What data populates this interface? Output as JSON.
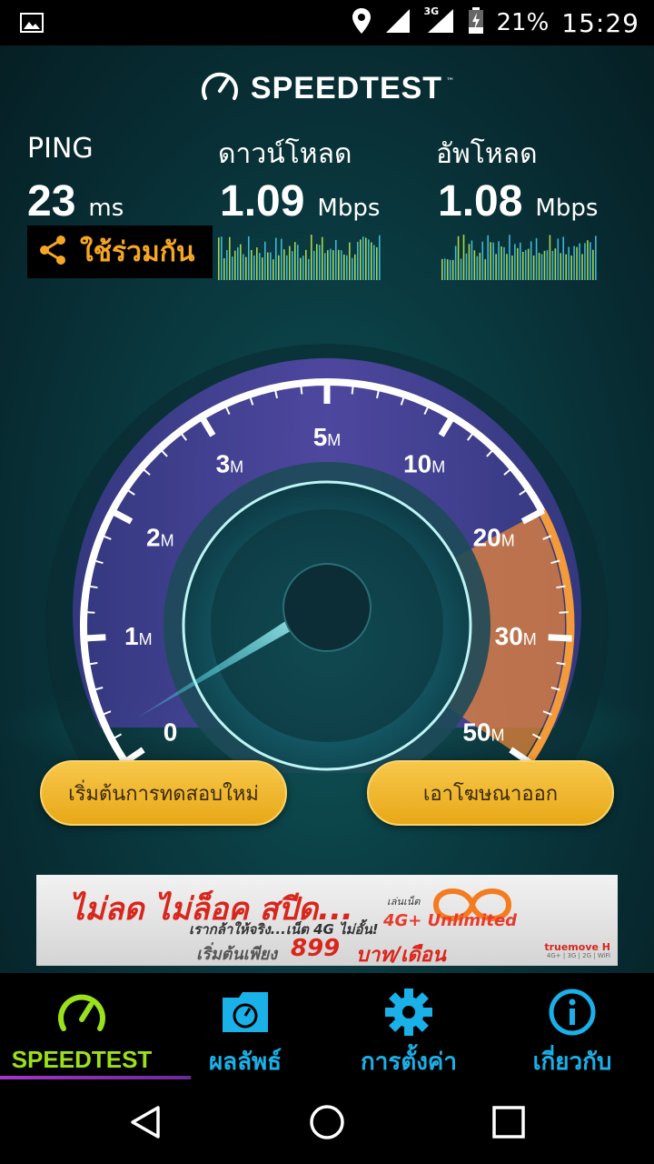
{
  "status": {
    "battery": "21%",
    "time": "15:29",
    "network": "3G"
  },
  "app": {
    "logo": "SPEEDTEST",
    "tm": "™"
  },
  "metrics": {
    "ping": {
      "label": "PING",
      "value": "23",
      "unit": "ms"
    },
    "download": {
      "label": "ดาวน์โหลด",
      "value": "1.09",
      "unit": "Mbps"
    },
    "upload": {
      "label": "อัพโหลด",
      "value": "1.08",
      "unit": "Mbps"
    }
  },
  "share": {
    "label": "ใช้ร่วมกัน"
  },
  "gauge": {
    "ticks": [
      {
        "num": "0",
        "unit": ""
      },
      {
        "num": "1",
        "unit": "M"
      },
      {
        "num": "2",
        "unit": "M"
      },
      {
        "num": "3",
        "unit": "M"
      },
      {
        "num": "5",
        "unit": "M"
      },
      {
        "num": "10",
        "unit": "M"
      },
      {
        "num": "20",
        "unit": "M"
      },
      {
        "num": "30",
        "unit": "M"
      },
      {
        "num": "50",
        "unit": "M"
      }
    ]
  },
  "buttons": {
    "restart": "เริ่มต้นการทดสอบใหม่",
    "remove_ads": "เอาโฆษณาออก"
  },
  "ad": {
    "headline": "ไม่ลด ไม่ล็อค สปีด...",
    "subline": "เรากล้าให้จริง...เน็ต 4G ไม่อั้น!",
    "price_prefix": "เริ่มต้นเพียง",
    "price": "899",
    "price_unit": "บาท/เดือน",
    "small": "เล่นเน็ต",
    "offer": "4G+ Unlimited",
    "brand": "truemove H",
    "brand_sub": "4G+ | 3G | 2G | WiFi"
  },
  "tabs": [
    {
      "label": "SPEEDTEST",
      "active": true
    },
    {
      "label": "ผลลัพธ์",
      "active": false
    },
    {
      "label": "การตั้งค่า",
      "active": false
    },
    {
      "label": "เกี่ยวกับ",
      "active": false
    }
  ],
  "colors": {
    "accent_gold": "#f5a623",
    "tab_cyan": "#1ab0e8",
    "tab_active": "#9be01c",
    "graph_green": "#a9d64a",
    "graph_cyan": "#3fb8d8",
    "gauge_orange": "#e8863a"
  }
}
